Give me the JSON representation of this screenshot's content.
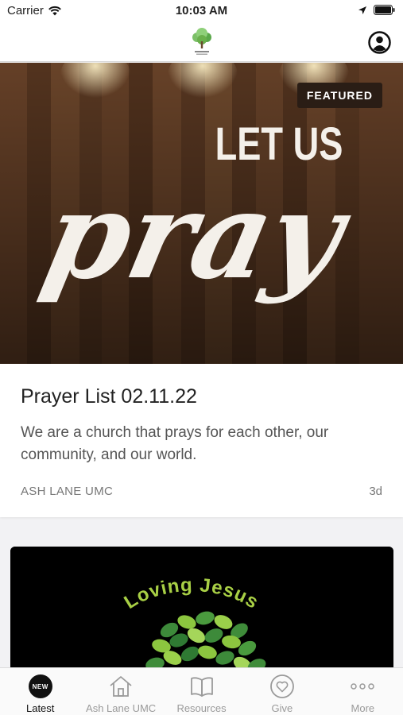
{
  "status_bar": {
    "carrier": "Carrier",
    "time": "10:03 AM"
  },
  "featured": {
    "badge": "FEATURED",
    "image_heading": "LET US",
    "image_script": "pray",
    "title": "Prayer List 02.11.22",
    "description": "We are a church that prays for each other, our community, and our world.",
    "source": "ASH LANE UMC",
    "age": "3d"
  },
  "second_card": {
    "image_text": "Loving Jesus"
  },
  "tabs": [
    {
      "label": "Latest",
      "badge": "NEW",
      "icon": "new-badge-icon",
      "active": true
    },
    {
      "label": "Ash Lane UMC",
      "icon": "home-icon",
      "active": false
    },
    {
      "label": "Resources",
      "icon": "book-icon",
      "active": false
    },
    {
      "label": "Give",
      "icon": "heart-icon",
      "active": false
    },
    {
      "label": "More",
      "icon": "more-icon",
      "active": false
    }
  ],
  "colors": {
    "accent": "#111111",
    "wood": "#5a3a23",
    "tree_green": "#6ab04c"
  }
}
